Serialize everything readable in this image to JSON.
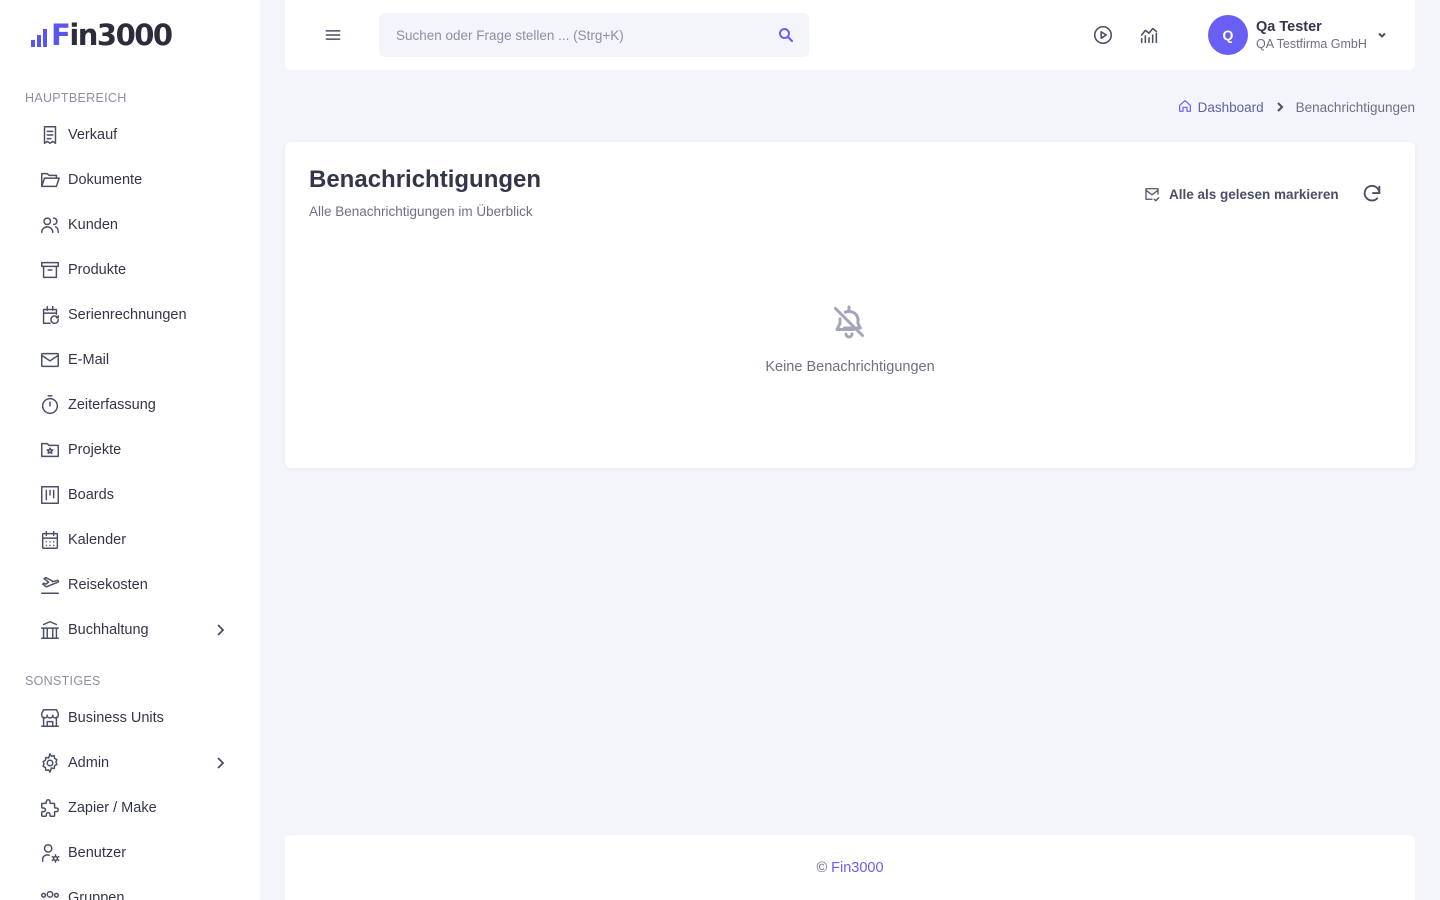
{
  "brand": {
    "logo_text": "Fin3000",
    "accent": "#6a5ff4"
  },
  "sidebar": {
    "sections": [
      {
        "label": "HAUPTBEREICH",
        "items": [
          {
            "label": "Verkauf",
            "icon": "receipt-icon"
          },
          {
            "label": "Dokumente",
            "icon": "folder-open-icon"
          },
          {
            "label": "Kunden",
            "icon": "users-icon"
          },
          {
            "label": "Produkte",
            "icon": "archive-icon"
          },
          {
            "label": "Serienrechnungen",
            "icon": "calendar-repeat-icon"
          },
          {
            "label": "E-Mail",
            "icon": "mail-icon"
          },
          {
            "label": "Zeiterfassung",
            "icon": "stopwatch-icon"
          },
          {
            "label": "Projekte",
            "icon": "folder-star-icon"
          },
          {
            "label": "Boards",
            "icon": "kanban-icon"
          },
          {
            "label": "Kalender",
            "icon": "calendar-icon"
          },
          {
            "label": "Reisekosten",
            "icon": "plane-departure-icon"
          },
          {
            "label": "Buchhaltung",
            "icon": "bank-icon",
            "has_children": true
          }
        ]
      },
      {
        "label": "SONSTIGES",
        "items": [
          {
            "label": "Business Units",
            "icon": "store-icon"
          },
          {
            "label": "Admin",
            "icon": "gear-icon",
            "has_children": true
          },
          {
            "label": "Zapier / Make",
            "icon": "puzzle-icon"
          },
          {
            "label": "Benutzer",
            "icon": "user-cog-icon"
          },
          {
            "label": "Gruppen",
            "icon": "users-group-icon"
          }
        ]
      }
    ]
  },
  "header": {
    "search_placeholder": "Suchen oder Frage stellen ... (Strg+K)",
    "user": {
      "initial": "Q",
      "name": "Qa Tester",
      "company": "QA Testfirma GmbH"
    }
  },
  "breadcrumb": {
    "home": "Dashboard",
    "current": "Benachrichtigungen"
  },
  "page": {
    "title": "Benachrichtigungen",
    "subtitle": "Alle Benachrichtigungen im Überblick",
    "mark_all_read": "Alle als gelesen markieren",
    "empty_text": "Keine Benachrichtigungen"
  },
  "footer": {
    "copyright": "©",
    "brand": "Fin3000"
  }
}
